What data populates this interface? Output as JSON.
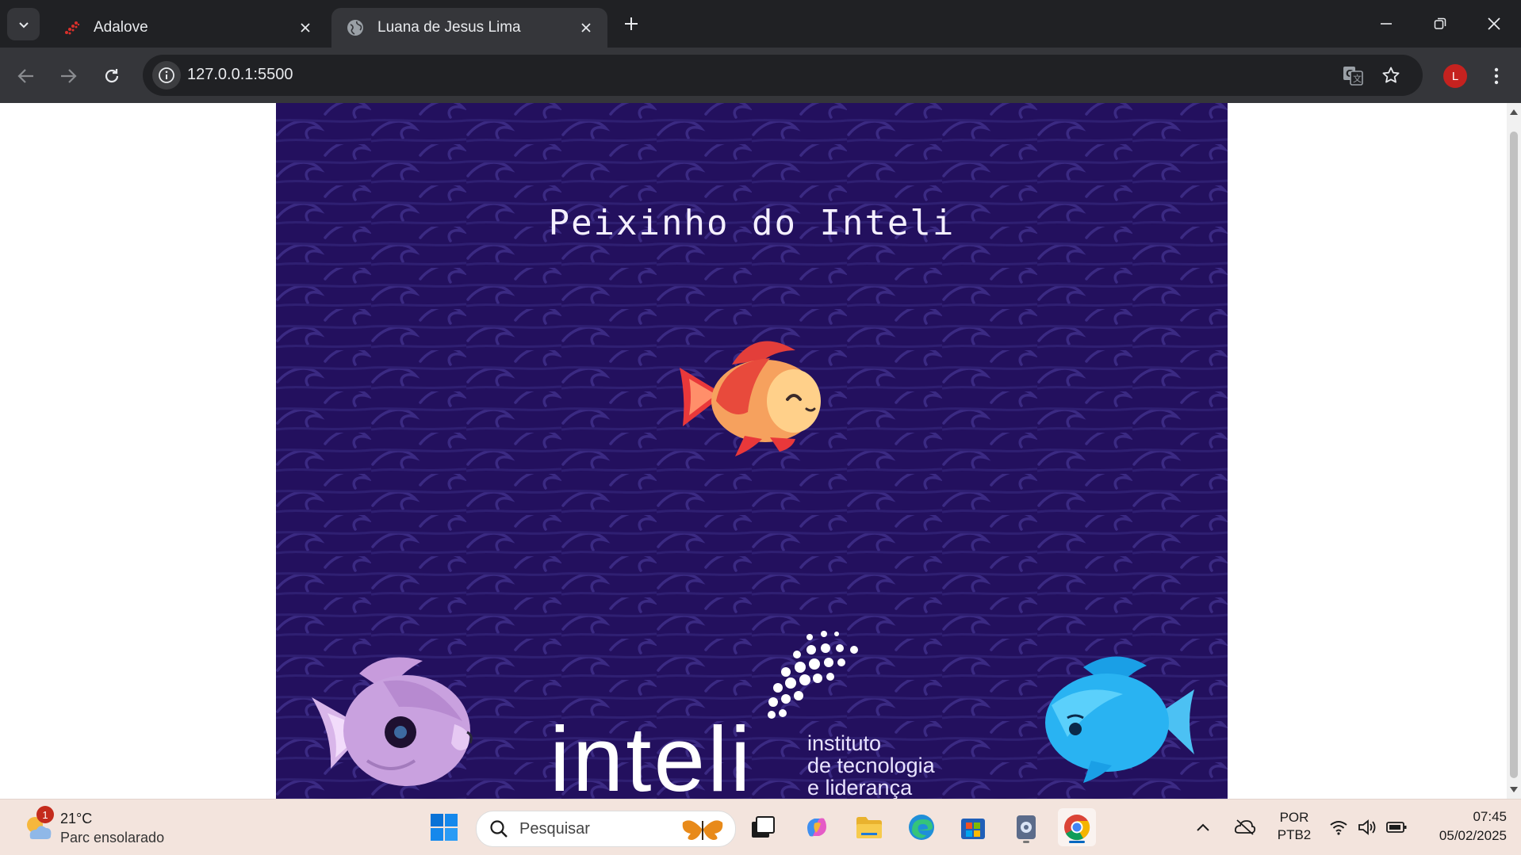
{
  "browser": {
    "tabs": [
      {
        "label": "Adalove",
        "icon": "adalove-favicon",
        "active": false
      },
      {
        "label": "Luana de Jesus Lima",
        "icon": "globe-icon",
        "active": true
      }
    ],
    "address": "127.0.0.1:5500",
    "profile_initial": "L",
    "profile_color": "#c5221f"
  },
  "page": {
    "title": "Peixinho do Inteli",
    "background_color": "#23105e",
    "logo": {
      "word": "inteli",
      "tagline_line1": "instituto",
      "tagline_line2": "de tecnologia",
      "tagline_line3": "e liderança"
    }
  },
  "taskbar": {
    "weather": {
      "badge": "1",
      "temp": "21°C",
      "condition": "Parc ensolarado"
    },
    "search_placeholder": "Pesquisar",
    "language": "POR",
    "keyboard": "PTB2",
    "time": "07:45",
    "date": "05/02/2025"
  }
}
